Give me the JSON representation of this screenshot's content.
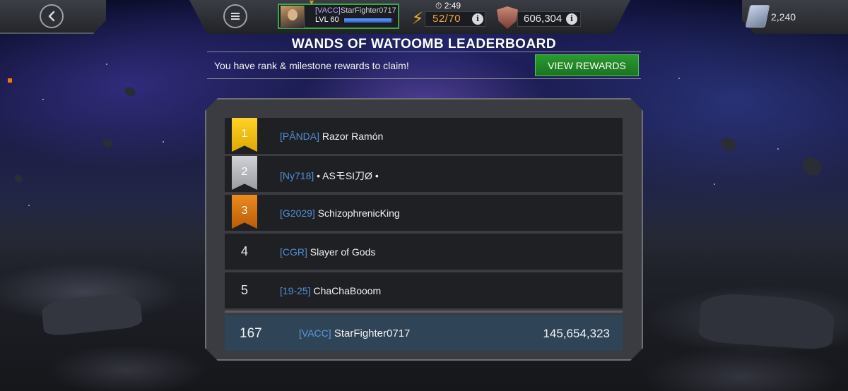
{
  "topbar": {
    "back_icon": "chevron-left-icon",
    "menu_icon": "hamburger-menu-icon",
    "player": {
      "alliance_tag": "[VACC]",
      "name": "StarFighter0717",
      "level": "LVL 60",
      "xp_progress": 0.95
    },
    "energy": {
      "timer": "2:49",
      "value": "52/70",
      "color": "#f4a53a"
    },
    "rating": {
      "value": "606,304"
    },
    "units": {
      "value": "2,240"
    }
  },
  "leaderboard": {
    "title": "WANDS OF WATOOMB LEADERBOARD",
    "notice": "You have rank & milestone rewards to claim!",
    "view_rewards_label": "VIEW REWARDS",
    "rows": [
      {
        "rank": "1",
        "alliance": "[PÂNDA]",
        "name": "Razor Ramón",
        "medal": "gold"
      },
      {
        "rank": "2",
        "alliance": "[Ny718]",
        "name": "• ASモSI刀Ø •",
        "medal": "silver"
      },
      {
        "rank": "3",
        "alliance": "[G2029]",
        "name": "SchizophrenicKing",
        "medal": "bronze"
      },
      {
        "rank": "4",
        "alliance": "[CGR]",
        "name": "Slayer of Gods",
        "medal": "none"
      },
      {
        "rank": "5",
        "alliance": "[19-25]",
        "name": "ChaChaBooom",
        "medal": "none"
      }
    ],
    "current_player": {
      "rank": "167",
      "alliance": "[VACC]",
      "name": "StarFighter0717",
      "score": "145,654,323"
    }
  },
  "colors": {
    "gold": "#ffd229",
    "silver": "#c0c2c6",
    "bronze": "#e07a14",
    "alliance_text": "#4f8fd6",
    "view_rewards_green": "#2a9a2f"
  }
}
